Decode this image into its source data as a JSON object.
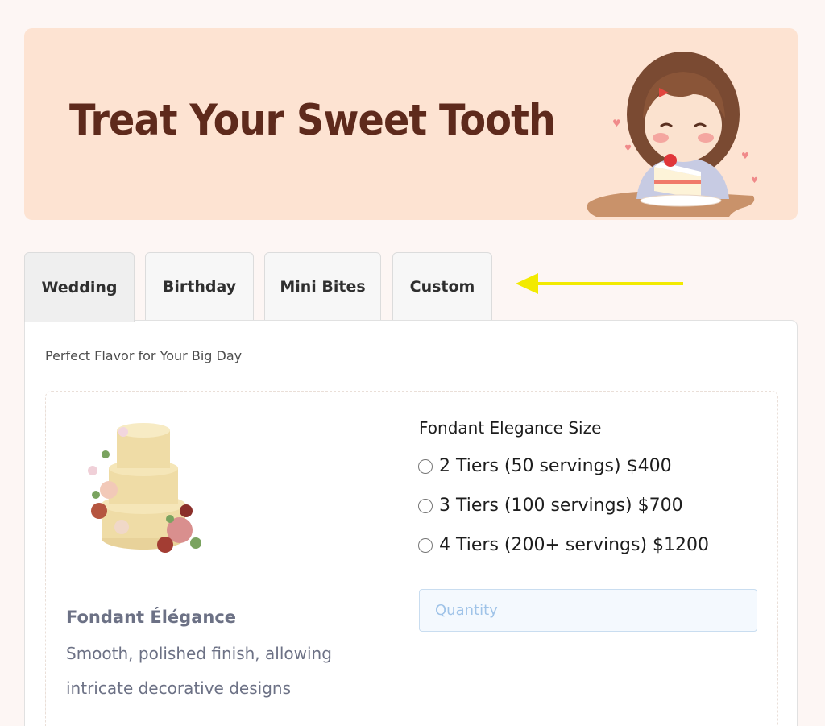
{
  "banner": {
    "title": "Treat Your Sweet Tooth",
    "illustration_icon": "girl-eating-cake-illustration",
    "background_color": "#fde3d2",
    "title_color": "#5e2a1c"
  },
  "tabs": [
    {
      "label": "Wedding",
      "active": true
    },
    {
      "label": "Birthday",
      "active": false
    },
    {
      "label": "Mini Bites",
      "active": false
    },
    {
      "label": "Custom",
      "active": false
    }
  ],
  "annotation": {
    "arrow_icon": "yellow-arrow-left-icon",
    "arrow_color": "#f2ea00"
  },
  "panel": {
    "subtitle": "Perfect Flavor for Your Big Day",
    "product": {
      "image_icon": "wedding-cake-illustration",
      "name": "Fondant Élégance",
      "description": "Smooth, polished finish, allowing intricate decorative designs",
      "size_title": "Fondant Elegance Size",
      "options": [
        {
          "label": "2 Tiers (50 servings) $400",
          "selected": false
        },
        {
          "label": "3 Tiers (100 servings) $700",
          "selected": false
        },
        {
          "label": "4 Tiers (200+ servings) $1200",
          "selected": false
        }
      ],
      "quantity": {
        "placeholder": "Quantity",
        "value": ""
      }
    }
  }
}
